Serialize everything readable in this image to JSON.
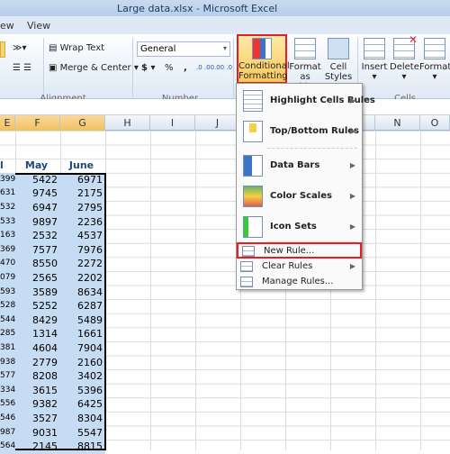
{
  "window": {
    "title": "Large data.xlsx  -  Microsoft Excel"
  },
  "tabs": [
    "ew",
    "View"
  ],
  "ribbon": {
    "wrap_text": "Wrap Text",
    "merge_center": "Merge & Center ▾",
    "alignment_label": "Alignment",
    "number_format": "General",
    "currency": "$ ▾",
    "percent": "%",
    "comma": ",",
    "inc_decimal": ".0 .00",
    "dec_decimal": ".00 .0",
    "number_label": "Number",
    "conditional_formatting": [
      "Conditional",
      "Formatting ▾"
    ],
    "format_as_table": [
      "Format",
      "as Table ▾"
    ],
    "cell_styles": [
      "Cell",
      "Styles ▾"
    ],
    "insert": "Insert",
    "delete": "Delete",
    "format": "Format",
    "cells_label": "Cells"
  },
  "columns": [
    "E",
    "F",
    "G",
    "H",
    "I",
    "J",
    "K",
    "L",
    "M",
    "N",
    "O"
  ],
  "sheet": {
    "headers": [
      "l",
      "May",
      "June"
    ],
    "rows": [
      [
        "399",
        "5422",
        "6971"
      ],
      [
        "631",
        "9745",
        "2175"
      ],
      [
        "532",
        "6947",
        "2795"
      ],
      [
        "533",
        "9897",
        "2236"
      ],
      [
        "163",
        "2532",
        "4537"
      ],
      [
        "369",
        "7577",
        "7976"
      ],
      [
        "470",
        "8550",
        "2272"
      ],
      [
        "079",
        "2565",
        "2202"
      ],
      [
        "593",
        "3589",
        "8634"
      ],
      [
        "528",
        "5252",
        "6287"
      ],
      [
        "544",
        "8429",
        "5489"
      ],
      [
        "285",
        "1314",
        "1661"
      ],
      [
        "381",
        "4604",
        "7904"
      ],
      [
        "938",
        "2779",
        "2160"
      ],
      [
        "577",
        "8208",
        "3402"
      ],
      [
        "334",
        "3615",
        "5396"
      ],
      [
        "556",
        "9382",
        "6425"
      ],
      [
        "546",
        "3527",
        "8304"
      ],
      [
        "987",
        "9031",
        "5547"
      ],
      [
        "564",
        "2145",
        "8815"
      ]
    ]
  },
  "menu": {
    "items": [
      {
        "label": "Highlight Cells Rules",
        "icon": "highlight-cells-icon"
      },
      {
        "label": "Top/Bottom Rules",
        "icon": "top-bottom-icon"
      },
      {
        "label": "Data Bars",
        "icon": "data-bars-icon"
      },
      {
        "label": "Color Scales",
        "icon": "color-scales-icon"
      },
      {
        "label": "Icon Sets",
        "icon": "icon-sets-icon"
      }
    ],
    "new_rule": "New Rule...",
    "clear_rules": "Clear Rules",
    "manage_rules": "Manage Rules..."
  },
  "colors": {
    "highlight": "#e31e24",
    "selection": "#c5dcf3",
    "selected_header": "#f1c15f"
  }
}
